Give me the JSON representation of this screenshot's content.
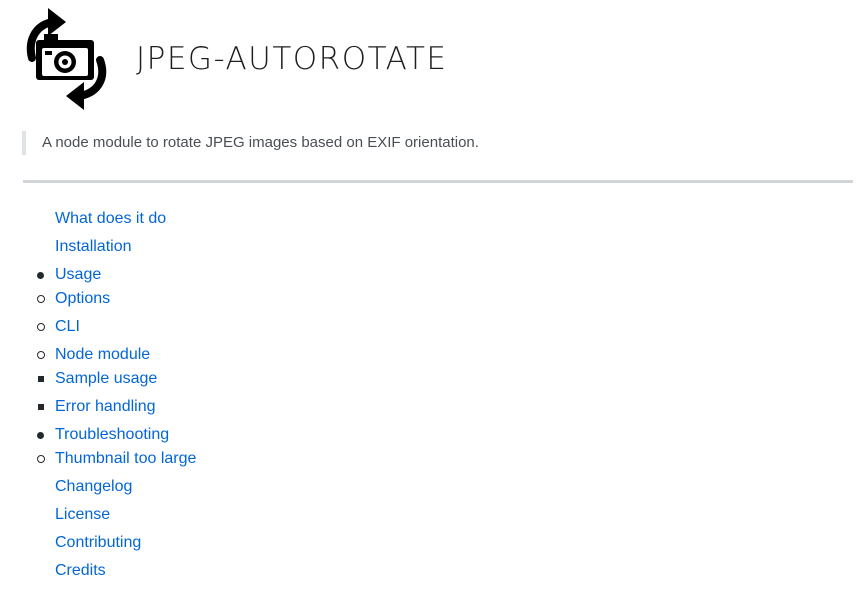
{
  "header": {
    "logo_icon": "rotating-camera-icon",
    "title": "JPEG-AUTOROTATE"
  },
  "description": "A node module to rotate JPEG images based on EXIF orientation.",
  "toc": {
    "items": [
      {
        "label": "What does it do"
      },
      {
        "label": "Installation"
      },
      {
        "label": "Usage",
        "children": [
          {
            "label": "Options"
          },
          {
            "label": "CLI"
          },
          {
            "label": "Node module",
            "children": [
              {
                "label": "Sample usage"
              },
              {
                "label": "Error handling"
              }
            ]
          }
        ]
      },
      {
        "label": "Troubleshooting",
        "children": [
          {
            "label": "Thumbnail too large"
          }
        ]
      },
      {
        "label": "Changelog"
      },
      {
        "label": "License"
      },
      {
        "label": "Contributing"
      },
      {
        "label": "Credits"
      }
    ]
  },
  "colors": {
    "link": "#0366d6",
    "text": "#24292e",
    "rule": "#d1d5da",
    "quote_border": "#dfe2e5",
    "quote_text": "#4a4f55"
  }
}
